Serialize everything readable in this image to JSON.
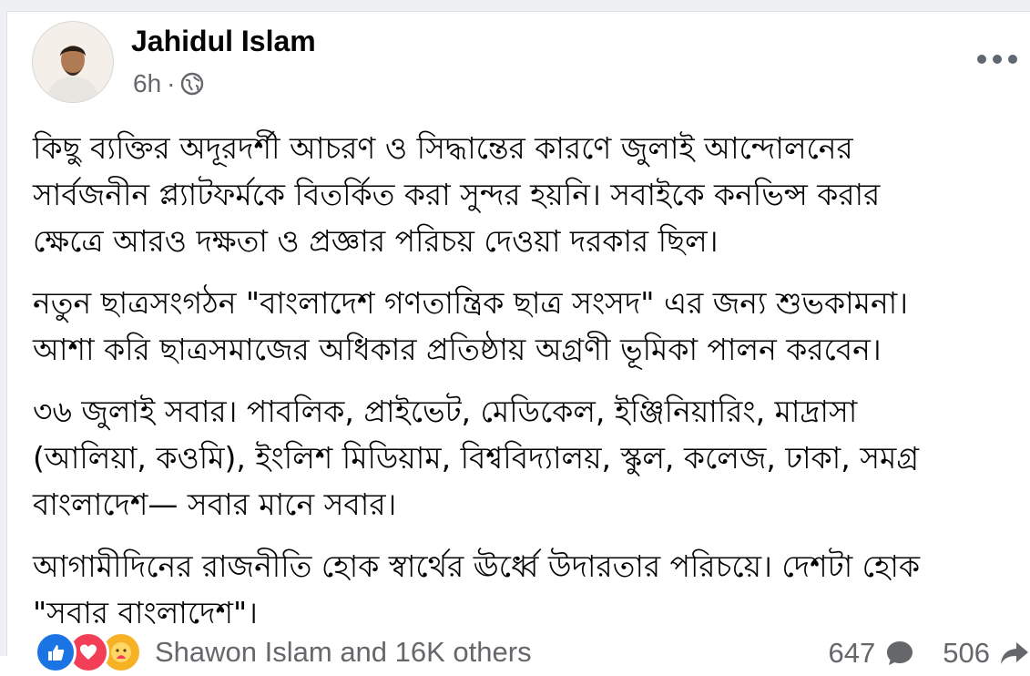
{
  "post": {
    "author": "Jahidul Islam",
    "time": "6h",
    "separator": "·",
    "paragraphs": [
      "কিছু ব্যক্তির অদূরদর্শী আচরণ ও সিদ্ধান্তের কারণে জুলাই আন্দোলনের\nসার্বজনীন প্ল্যাটফর্মকে বিতর্কিত করা সুন্দর হয়নি। সবাইকে কনভিন্স করার\nক্ষেত্রে আরও দক্ষতা ও প্রজ্ঞার পরিচয় দেওয়া দরকার ছিল।",
      "নতুন ছাত্রসংগঠন \"বাংলাদেশ গণতান্ত্রিক ছাত্র সংসদ\" এর জন্য শুভকামনা।\nআশা করি ছাত্রসমাজের অধিকার প্রতিষ্ঠায় অগ্রণী ভূমিকা পালন করবেন।",
      "৩৬ জুলাই সবার। পাবলিক, প্রাইভেট, মেডিকেল, ইঞ্জিনিয়ারিং, মাদ্রাসা\n(আলিয়া, কওমি), ইংলিশ মিডিয়াম, বিশ্ববিদ্যালয়, স্কুল, কলেজ, ঢাকা, সমগ্র\nবাংলাদেশ— সবার মানে সবার।",
      "আগামীদিনের রাজনীতি হোক স্বার্থের ঊর্ধ্বে উদারতার পরিচয়ে। দেশটা হোক\n\"সবার বাংলাদেশ\"।"
    ],
    "reactions": {
      "icons": [
        "like-icon",
        "love-icon",
        "care-icon"
      ],
      "summary": "Shawon Islam and 16K others"
    },
    "comment_count": "647",
    "share_count": "506",
    "colors": {
      "like": "#1b74e4",
      "love": "#f33e58",
      "care": "#f7b125",
      "secondary_text": "#65676b"
    }
  }
}
